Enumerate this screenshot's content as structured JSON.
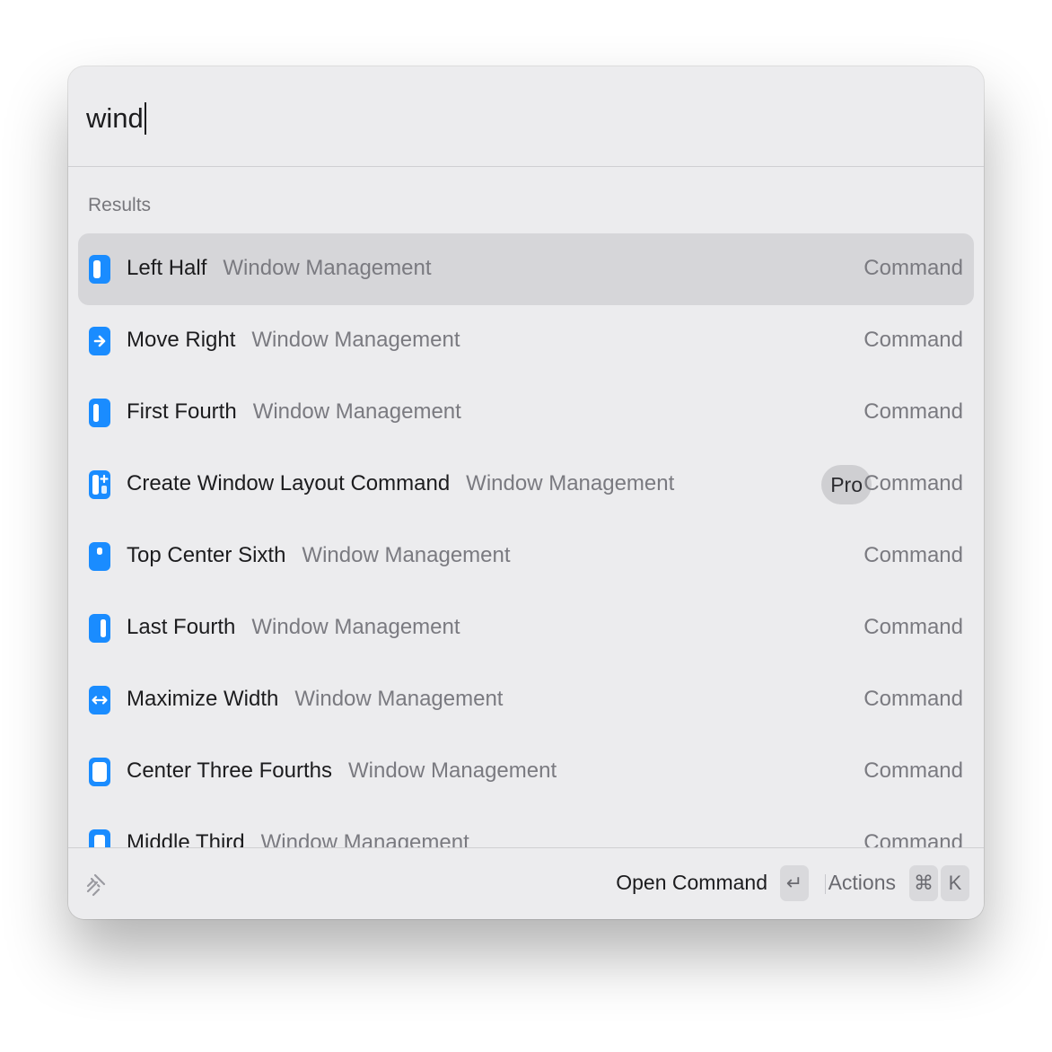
{
  "search": {
    "value": "wind",
    "placeholder": ""
  },
  "results": {
    "section_title": "Results",
    "items": [
      {
        "title": "Left Half",
        "subtitle": "Window Management",
        "accessory": "Command",
        "badge": "",
        "icon": "left-half-icon",
        "selected": true
      },
      {
        "title": "Move Right",
        "subtitle": "Window Management",
        "accessory": "Command",
        "badge": "",
        "icon": "move-right-icon",
        "selected": false
      },
      {
        "title": "First Fourth",
        "subtitle": "Window Management",
        "accessory": "Command",
        "badge": "",
        "icon": "first-fourth-icon",
        "selected": false
      },
      {
        "title": "Create Window Layout Command",
        "subtitle": "Window Management",
        "accessory": "Command",
        "badge": "Pro",
        "icon": "create-layout-icon",
        "selected": false
      },
      {
        "title": "Top Center Sixth",
        "subtitle": "Window Management",
        "accessory": "Command",
        "badge": "",
        "icon": "top-center-sixth-icon",
        "selected": false
      },
      {
        "title": "Last Fourth",
        "subtitle": "Window Management",
        "accessory": "Command",
        "badge": "",
        "icon": "last-fourth-icon",
        "selected": false
      },
      {
        "title": "Maximize Width",
        "subtitle": "Window Management",
        "accessory": "Command",
        "badge": "",
        "icon": "maximize-width-icon",
        "selected": false
      },
      {
        "title": "Center Three Fourths",
        "subtitle": "Window Management",
        "accessory": "Command",
        "badge": "",
        "icon": "center-three-fourths-icon",
        "selected": false
      },
      {
        "title": "Middle Third",
        "subtitle": "Window Management",
        "accessory": "Command",
        "badge": "",
        "icon": "middle-third-icon",
        "selected": false
      }
    ]
  },
  "footer": {
    "logo_icon": "raycast-logo-icon",
    "primary_action": "Open Command",
    "enter_key": "↵",
    "actions_label": "Actions",
    "cmd_key": "⌘",
    "k_key": "K"
  },
  "colors": {
    "accent_blue": "#1a8cff",
    "selected_row": "#d6d6d9",
    "window_bg": "#ececee"
  }
}
